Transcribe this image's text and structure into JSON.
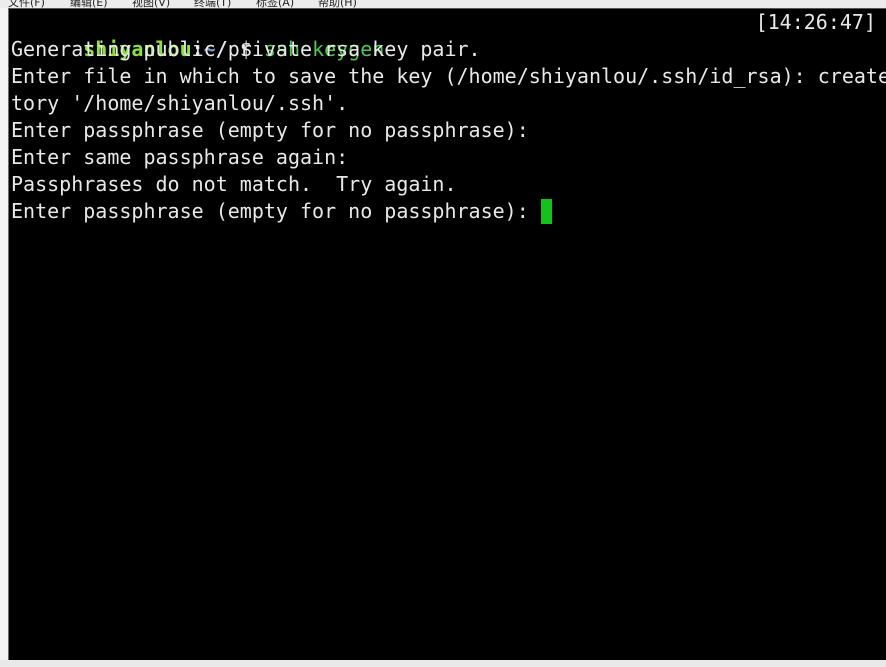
{
  "menubar": {
    "items": [
      "文件(F)",
      "编辑(E)",
      "视图(V)",
      "终端(T)",
      "标签(A)",
      "帮助(H)"
    ]
  },
  "terminal": {
    "prompt": {
      "user_host": "shiyanlou",
      "separator": ":",
      "path": "~/",
      "symbol": "$",
      "command": "ssh-keygen"
    },
    "clock": "[14:26:47]",
    "output_lines": [
      "Generating public/private rsa key pair.",
      "Enter file in which to save the key (/home/shiyanlou/.ssh/id_rsa): created direc",
      "tory '/home/shiyanlou/.ssh'.",
      "Enter passphrase (empty for no passphrase):",
      "Enter same passphrase again:",
      "Passphrases do not match.  Try again.",
      "Enter passphrase (empty for no passphrase): "
    ],
    "colors": {
      "background": "#000000",
      "text": "#e8e8e8",
      "user": "#8ae234",
      "path": "#729fcf",
      "command": "#4ec94e",
      "cursor": "#13c21a"
    }
  }
}
